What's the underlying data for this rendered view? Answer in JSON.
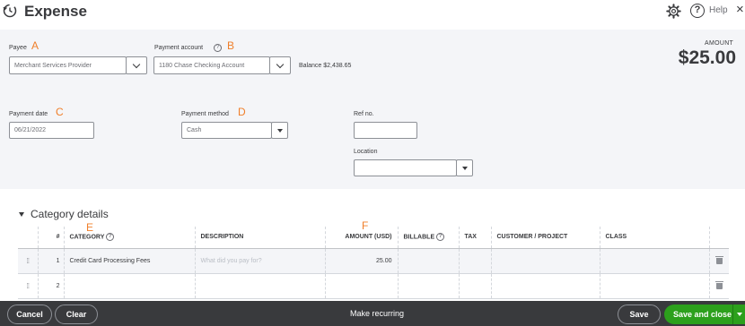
{
  "header": {
    "title": "Expense",
    "help_label": "Help",
    "help_glyph": "?",
    "close_glyph": "×"
  },
  "payee": {
    "label": "Payee",
    "marker": "A",
    "value": "Merchant Services Provider"
  },
  "payment_account": {
    "label": "Payment account",
    "marker": "B",
    "value": "1180 Chase Checking Account",
    "balance": "Balance $2,438.65"
  },
  "amount": {
    "label": "AMOUNT",
    "value": "$25.00"
  },
  "payment_date": {
    "label": "Payment date",
    "marker": "C",
    "value": "06/21/2022"
  },
  "payment_method": {
    "label": "Payment method",
    "marker": "D",
    "value": "Cash"
  },
  "ref_no": {
    "label": "Ref no.",
    "value": ""
  },
  "location": {
    "label": "Location",
    "value": ""
  },
  "category_details": {
    "title": "Category details",
    "marker_category": "E",
    "marker_amount": "F",
    "columns": [
      "#",
      "CATEGORY",
      "DESCRIPTION",
      "AMOUNT (USD)",
      "BILLABLE",
      "TAX",
      "CUSTOMER / PROJECT",
      "CLASS"
    ],
    "rows": [
      {
        "num": "1",
        "category": "Credit Card Processing Fees",
        "description_placeholder": "What did you pay for?",
        "amount": "25.00"
      },
      {
        "num": "2",
        "category": "",
        "description_placeholder": "",
        "amount": ""
      }
    ]
  },
  "footer": {
    "cancel": "Cancel",
    "clear": "Clear",
    "make_recurring": "Make recurring",
    "save": "Save",
    "save_and_close": "Save and close"
  },
  "colors": {
    "accent_green": "#2ca01c",
    "footer_bg": "#393a3d",
    "marker_orange": "#f07f2a",
    "panel_bg": "#f4f5f8"
  },
  "icons": {
    "header": "recent-transactions-icon",
    "settings": "gear-icon",
    "help": "help-circle-icon",
    "close": "close-icon",
    "drag": "drag-handle-icon",
    "delete": "trash-icon"
  }
}
